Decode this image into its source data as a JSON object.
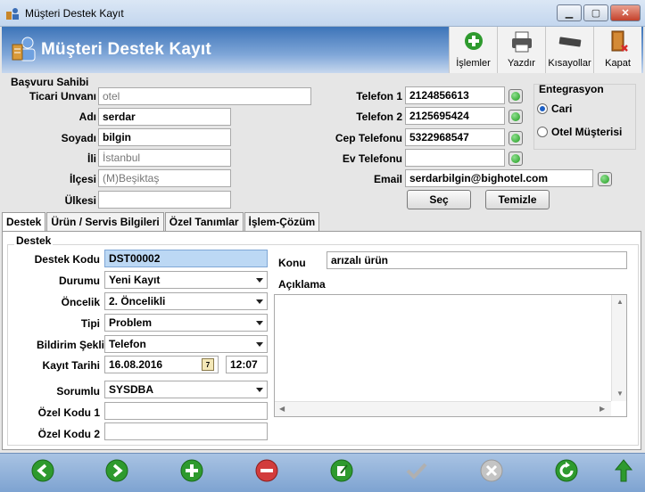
{
  "window": {
    "title": "Müşteri Destek Kayıt",
    "controls": [
      "minimize",
      "maximize",
      "close"
    ]
  },
  "header": {
    "title": "Müşteri Destek Kayıt"
  },
  "toolbar": {
    "items": [
      {
        "label": "İşlemler",
        "icon": "plus-icon"
      },
      {
        "label": "Yazdır",
        "icon": "printer-icon"
      },
      {
        "label": "Kısayollar",
        "icon": "keyboard-icon"
      },
      {
        "label": "Kapat",
        "icon": "exit-door-icon"
      }
    ]
  },
  "applicant": {
    "group_label": "Başvuru Sahibi",
    "fields": {
      "ticari_unvani": {
        "label": "Ticari Unvanı",
        "value": "otel"
      },
      "adi": {
        "label": "Adı",
        "value": "serdar"
      },
      "soyadi": {
        "label": "Soyadı",
        "value": "bilgin"
      },
      "ili": {
        "label": "İli",
        "value": "İstanbul"
      },
      "ilcesi": {
        "label": "İlçesi",
        "value": "(M)Beşiktaş"
      },
      "ulkesi": {
        "label": "Ülkesi",
        "value": ""
      },
      "telefon1": {
        "label": "Telefon 1",
        "value": "2124856613"
      },
      "telefon2": {
        "label": "Telefon 2",
        "value": "2125695424"
      },
      "cep_telefonu": {
        "label": "Cep Telefonu",
        "value": "5322968547"
      },
      "ev_telefonu": {
        "label": "Ev Telefonu",
        "value": ""
      },
      "email": {
        "label": "Email",
        "value": "serdarbilgin@bighotel.com"
      }
    },
    "buttons": {
      "sec": "Seç",
      "temizle": "Temizle"
    }
  },
  "integration": {
    "label": "Entegrasyon",
    "options": [
      {
        "label": "Cari",
        "checked": true
      },
      {
        "label": "Otel Müşterisi",
        "checked": false
      }
    ]
  },
  "tabs": [
    {
      "label": "Destek",
      "active": true
    },
    {
      "label": "Ürün / Servis Bilgileri",
      "active": false
    },
    {
      "label": "Özel Tanımlar",
      "active": false
    },
    {
      "label": "İşlem-Çözüm",
      "active": false
    }
  ],
  "support": {
    "group_label": "Destek",
    "destek_kodu": {
      "label": "Destek Kodu",
      "value": "DST00002"
    },
    "durumu": {
      "label": "Durumu",
      "value": "Yeni Kayıt"
    },
    "oncelik": {
      "label": "Öncelik",
      "value": "2. Öncelikli"
    },
    "tipi": {
      "label": "Tipi",
      "value": "Problem"
    },
    "bildirim_sekli": {
      "label": "Bildirim Şekli",
      "value": "Telefon"
    },
    "kayit_tarihi": {
      "label": "Kayıt Tarihi",
      "date": "16.08.2016",
      "time": "12:07"
    },
    "sorumlu": {
      "label": "Sorumlu",
      "value": "SYSDBA"
    },
    "ozel_kodu_1": {
      "label": "Özel Kodu 1",
      "value": ""
    },
    "ozel_kodu_2": {
      "label": "Özel Kodu 2",
      "value": ""
    },
    "konu": {
      "label": "Konu",
      "value": "arızalı ürün"
    },
    "aciklama": {
      "label": "Açıklama",
      "value": ""
    }
  },
  "footer": {
    "buttons": [
      {
        "name": "first-record-button",
        "icon": "arrow-left-icon",
        "color": "#2e9a2e"
      },
      {
        "name": "next-record-button",
        "icon": "arrow-right-icon",
        "color": "#2e9a2e"
      },
      {
        "name": "new-record-button",
        "icon": "plus-icon",
        "color": "#2e9a2e"
      },
      {
        "name": "delete-record-button",
        "icon": "minus-icon",
        "color": "#d23c3c"
      },
      {
        "name": "edit-record-button",
        "icon": "edit-icon",
        "color": "#2e9a2e"
      },
      {
        "name": "save-record-button",
        "icon": "checkmark-icon",
        "color": "#b0b0b0"
      },
      {
        "name": "cancel-record-button",
        "icon": "cancel-icon",
        "color": "#b0b0b0"
      },
      {
        "name": "refresh-button",
        "icon": "refresh-icon",
        "color": "#2e9a2e"
      },
      {
        "name": "top-button",
        "icon": "arrow-up-icon",
        "color": "#2e9a2e"
      }
    ]
  }
}
